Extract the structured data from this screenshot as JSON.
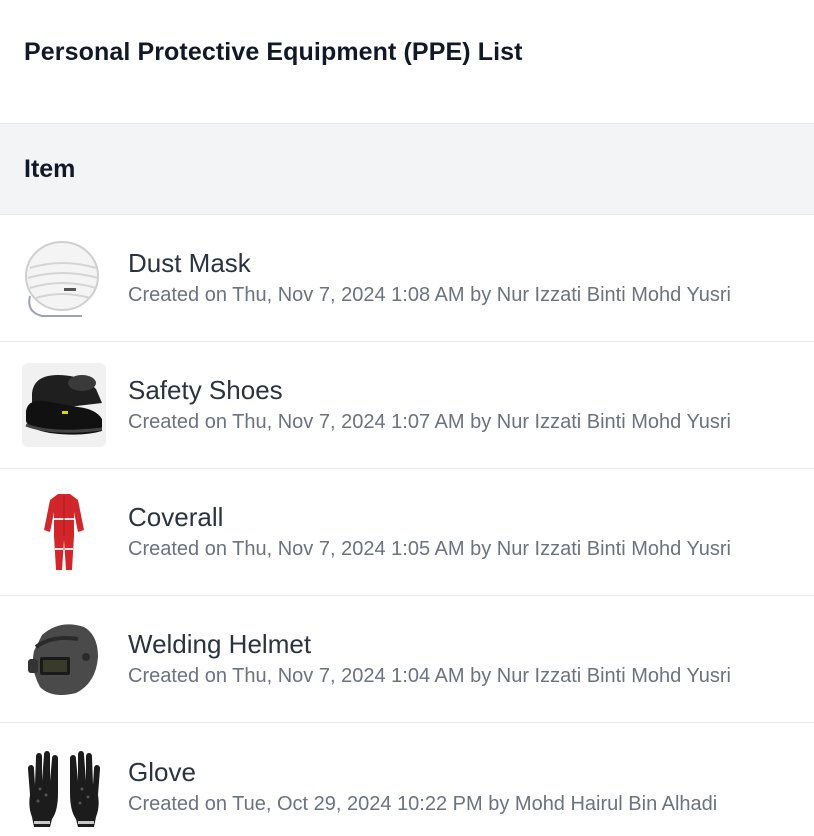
{
  "page": {
    "title": "Personal Protective Equipment (PPE) List"
  },
  "table": {
    "header": "Item"
  },
  "items": [
    {
      "name": "Dust Mask",
      "meta": "Created on Thu, Nov 7, 2024 1:08 AM by Nur Izzati Binti Mohd Yusri",
      "icon": "dust-mask-image"
    },
    {
      "name": "Safety Shoes",
      "meta": "Created on Thu, Nov 7, 2024 1:07 AM by Nur Izzati Binti Mohd Yusri",
      "icon": "safety-shoes-image"
    },
    {
      "name": "Coverall",
      "meta": "Created on Thu, Nov 7, 2024 1:05 AM by Nur Izzati Binti Mohd Yusri",
      "icon": "coverall-image"
    },
    {
      "name": "Welding Helmet",
      "meta": "Created on Thu, Nov 7, 2024 1:04 AM by Nur Izzati Binti Mohd Yusri",
      "icon": "welding-helmet-image"
    },
    {
      "name": "Glove",
      "meta": "Created on Tue, Oct 29, 2024 10:22 PM by Mohd Hairul Bin Alhadi",
      "icon": "glove-image"
    }
  ],
  "colors": {
    "header_bg": "#f3f4f6",
    "divider": "#e5e7eb",
    "title_text": "#111827",
    "meta_text": "#6b7280",
    "coverall_red": "#d3262b"
  }
}
